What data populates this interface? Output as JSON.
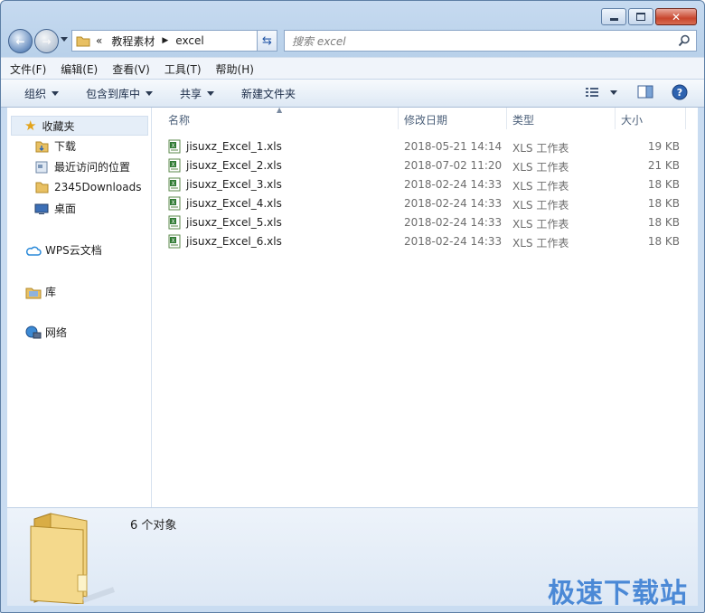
{
  "address": {
    "crumb_prefix": "«",
    "crumbs": [
      "教程素材",
      "excel"
    ],
    "search_placeholder": "搜索 excel"
  },
  "menubar": [
    "文件(F)",
    "编辑(E)",
    "查看(V)",
    "工具(T)",
    "帮助(H)"
  ],
  "toolbar": {
    "organize": "组织",
    "include_library": "包含到库中",
    "share": "共享",
    "new_folder": "新建文件夹"
  },
  "nav": {
    "favorites": "收藏夹",
    "items": [
      "下载",
      "最近访问的位置",
      "2345Downloads",
      "桌面"
    ],
    "wps": "WPS云文档",
    "library": "库",
    "network": "网络"
  },
  "columns": {
    "name": "名称",
    "modified": "修改日期",
    "type": "类型",
    "size": "大小"
  },
  "files": [
    {
      "name": "jisuxz_Excel_1.xls",
      "modified": "2018-05-21 14:14",
      "type": "XLS 工作表",
      "size": "19 KB"
    },
    {
      "name": "jisuxz_Excel_2.xls",
      "modified": "2018-07-02 11:20",
      "type": "XLS 工作表",
      "size": "21 KB"
    },
    {
      "name": "jisuxz_Excel_3.xls",
      "modified": "2018-02-24 14:33",
      "type": "XLS 工作表",
      "size": "18 KB"
    },
    {
      "name": "jisuxz_Excel_4.xls",
      "modified": "2018-02-24 14:33",
      "type": "XLS 工作表",
      "size": "18 KB"
    },
    {
      "name": "jisuxz_Excel_5.xls",
      "modified": "2018-02-24 14:33",
      "type": "XLS 工作表",
      "size": "18 KB"
    },
    {
      "name": "jisuxz_Excel_6.xls",
      "modified": "2018-02-24 14:33",
      "type": "XLS 工作表",
      "size": "18 KB"
    }
  ],
  "details": {
    "count": "6 个对象"
  },
  "watermark": "极速下载站"
}
